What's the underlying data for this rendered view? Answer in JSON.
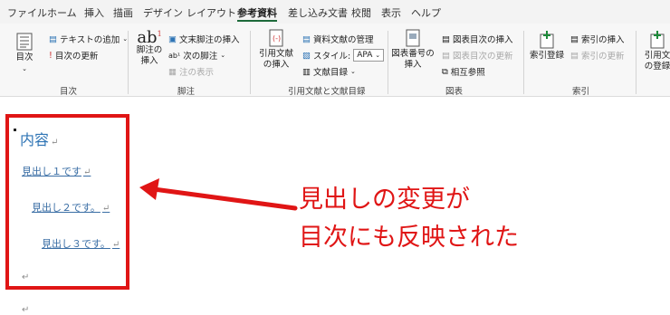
{
  "menu_tabs": [
    "ファイル",
    "ホーム",
    "挿入",
    "描画",
    "デザイン",
    "レイアウト",
    "参考資料",
    "差し込み文書",
    "校閲",
    "表示",
    "ヘルプ"
  ],
  "ribbon": {
    "toc": {
      "toc_button": "目次",
      "add_text": "テキストの追加",
      "update_toc": "目次の更新",
      "group_label": "目次"
    },
    "footnotes": {
      "insert_footnote": "脚注の挿入",
      "insert_endnote": "文末脚注の挿入",
      "next_footnote": "次の脚注",
      "show_notes": "注の表示",
      "group_label": "脚注"
    },
    "citations": {
      "insert_citation": "引用文献の挿入",
      "manage_sources": "資料文献の管理",
      "style_label": "スタイル:",
      "style_value": "APA",
      "bibliography": "文献目録",
      "group_label": "引用文献と文献目録"
    },
    "captions": {
      "insert_caption": "図表番号の挿入",
      "insert_table_of_figures": "図表目次の挿入",
      "update_table": "図表目次の更新",
      "cross_reference": "相互参照",
      "group_label": "図表"
    },
    "index": {
      "mark_entry": "索引登録",
      "insert_index": "索引の挿入",
      "update_index": "索引の更新",
      "group_label": "索引"
    },
    "table_of_authorities": {
      "mark_citation": "引用文の登録"
    }
  },
  "document": {
    "toc_title": "内容",
    "toc_entries": [
      "見出し１です",
      "見出し２です。",
      "見出し３です。"
    ],
    "paragraph_mark": "↵"
  },
  "annotation": {
    "line1": "見出しの変更が",
    "line2": "目次にも反映された"
  },
  "colors": {
    "accent_red": "#e01515",
    "toc_blue": "#2e74b5"
  }
}
